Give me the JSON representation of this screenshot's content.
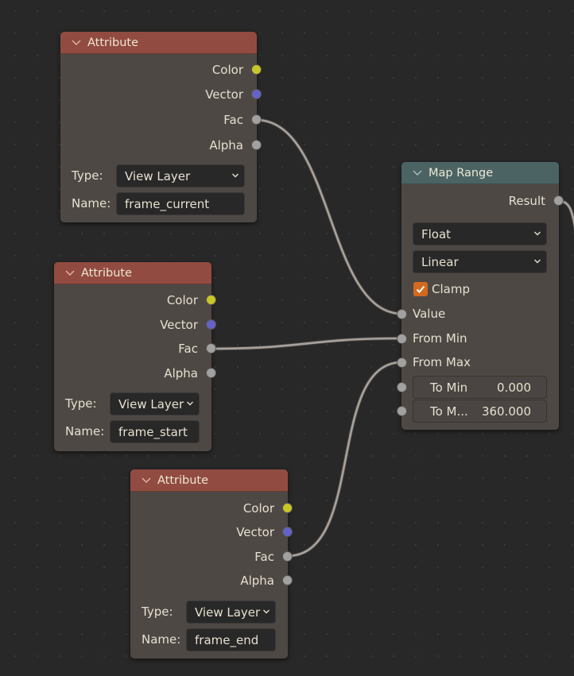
{
  "colors": {
    "background": "#282828",
    "node_body": "#4e4845",
    "attribute_header": "#924b40",
    "converter_header": "#4b6463",
    "socket_color": "#c7c729",
    "socket_vector": "#6363c7",
    "socket_float": "#a1a1a1",
    "checkbox_accent": "#d26a1e",
    "wire": "#a6a29e"
  },
  "nodes": {
    "attr_current": {
      "title": "Attribute",
      "outputs": [
        "Color",
        "Vector",
        "Fac",
        "Alpha"
      ],
      "type_label": "Type:",
      "type_value": "View Layer",
      "name_label": "Name:",
      "name_value": "frame_current"
    },
    "attr_start": {
      "title": "Attribute",
      "outputs": [
        "Color",
        "Vector",
        "Fac",
        "Alpha"
      ],
      "type_label": "Type:",
      "type_value": "View Layer",
      "name_label": "Name:",
      "name_value": "frame_start"
    },
    "attr_end": {
      "title": "Attribute",
      "outputs": [
        "Color",
        "Vector",
        "Fac",
        "Alpha"
      ],
      "type_label": "Type:",
      "type_value": "View Layer",
      "name_label": "Name:",
      "name_value": "frame_end"
    },
    "map_range": {
      "title": "Map Range",
      "output": "Result",
      "data_type": "Float",
      "interpolation": "Linear",
      "clamp_label": "Clamp",
      "clamp_checked": true,
      "inputs": [
        "Value",
        "From Min",
        "From Max"
      ],
      "to_min_label": "To Min",
      "to_min_value": "0.000",
      "to_max_label": "To M...",
      "to_max_value": "360.000"
    }
  },
  "links": [
    {
      "from": "attr_current.Fac",
      "to": "map_range.Value"
    },
    {
      "from": "attr_start.Fac",
      "to": "map_range.From Min"
    },
    {
      "from": "attr_end.Fac",
      "to": "map_range.From Max"
    },
    {
      "from": "map_range.Result",
      "to": "offscreen"
    }
  ]
}
